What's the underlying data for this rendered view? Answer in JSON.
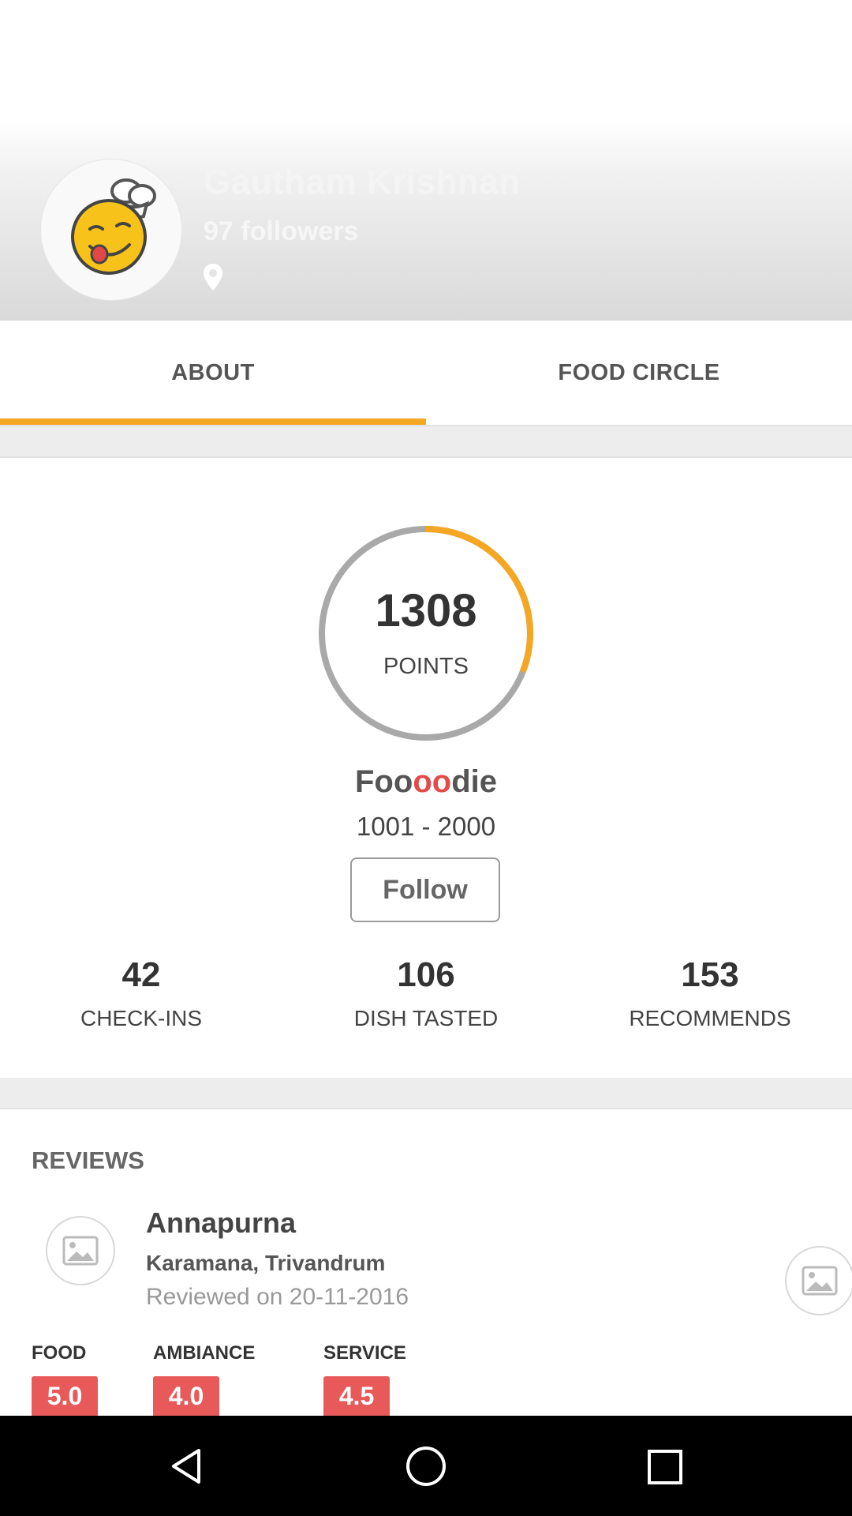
{
  "profile": {
    "name": "Gautham Krishnan",
    "followers": "97 followers",
    "avatar_icon": "chef-emoji-icon",
    "location_icon": "location-pin-icon"
  },
  "tabs": [
    {
      "label": "ABOUT",
      "active": true
    },
    {
      "label": "FOOD CIRCLE",
      "active": false
    }
  ],
  "points": {
    "value": "1308",
    "label": "POINTS",
    "progress_fraction": 0.31,
    "level_prefix": "Foo",
    "level_highlight": "oo",
    "level_suffix": "die",
    "level_range": "1001 - 2000",
    "follow_label": "Follow"
  },
  "stats": [
    {
      "value": "42",
      "label": "CHECK-INS"
    },
    {
      "value": "106",
      "label": "DISH TASTED"
    },
    {
      "value": "153",
      "label": "RECOMMENDS"
    }
  ],
  "reviews": {
    "title": "REVIEWS",
    "item": {
      "restaurant": "Annapurna",
      "location": "Karamana, Trivandrum",
      "date": "Reviewed on 20-11-2016",
      "ratings": [
        {
          "label": "FOOD",
          "value": "5.0"
        },
        {
          "label": "AMBIANCE",
          "value": "4.0"
        },
        {
          "label": "SERVICE",
          "value": "4.5"
        }
      ]
    }
  },
  "colors": {
    "accent": "#f5a623",
    "rating": "#e85a5a",
    "highlight": "#e34a4a"
  },
  "navbar": [
    "back-icon",
    "home-icon",
    "recents-icon"
  ]
}
